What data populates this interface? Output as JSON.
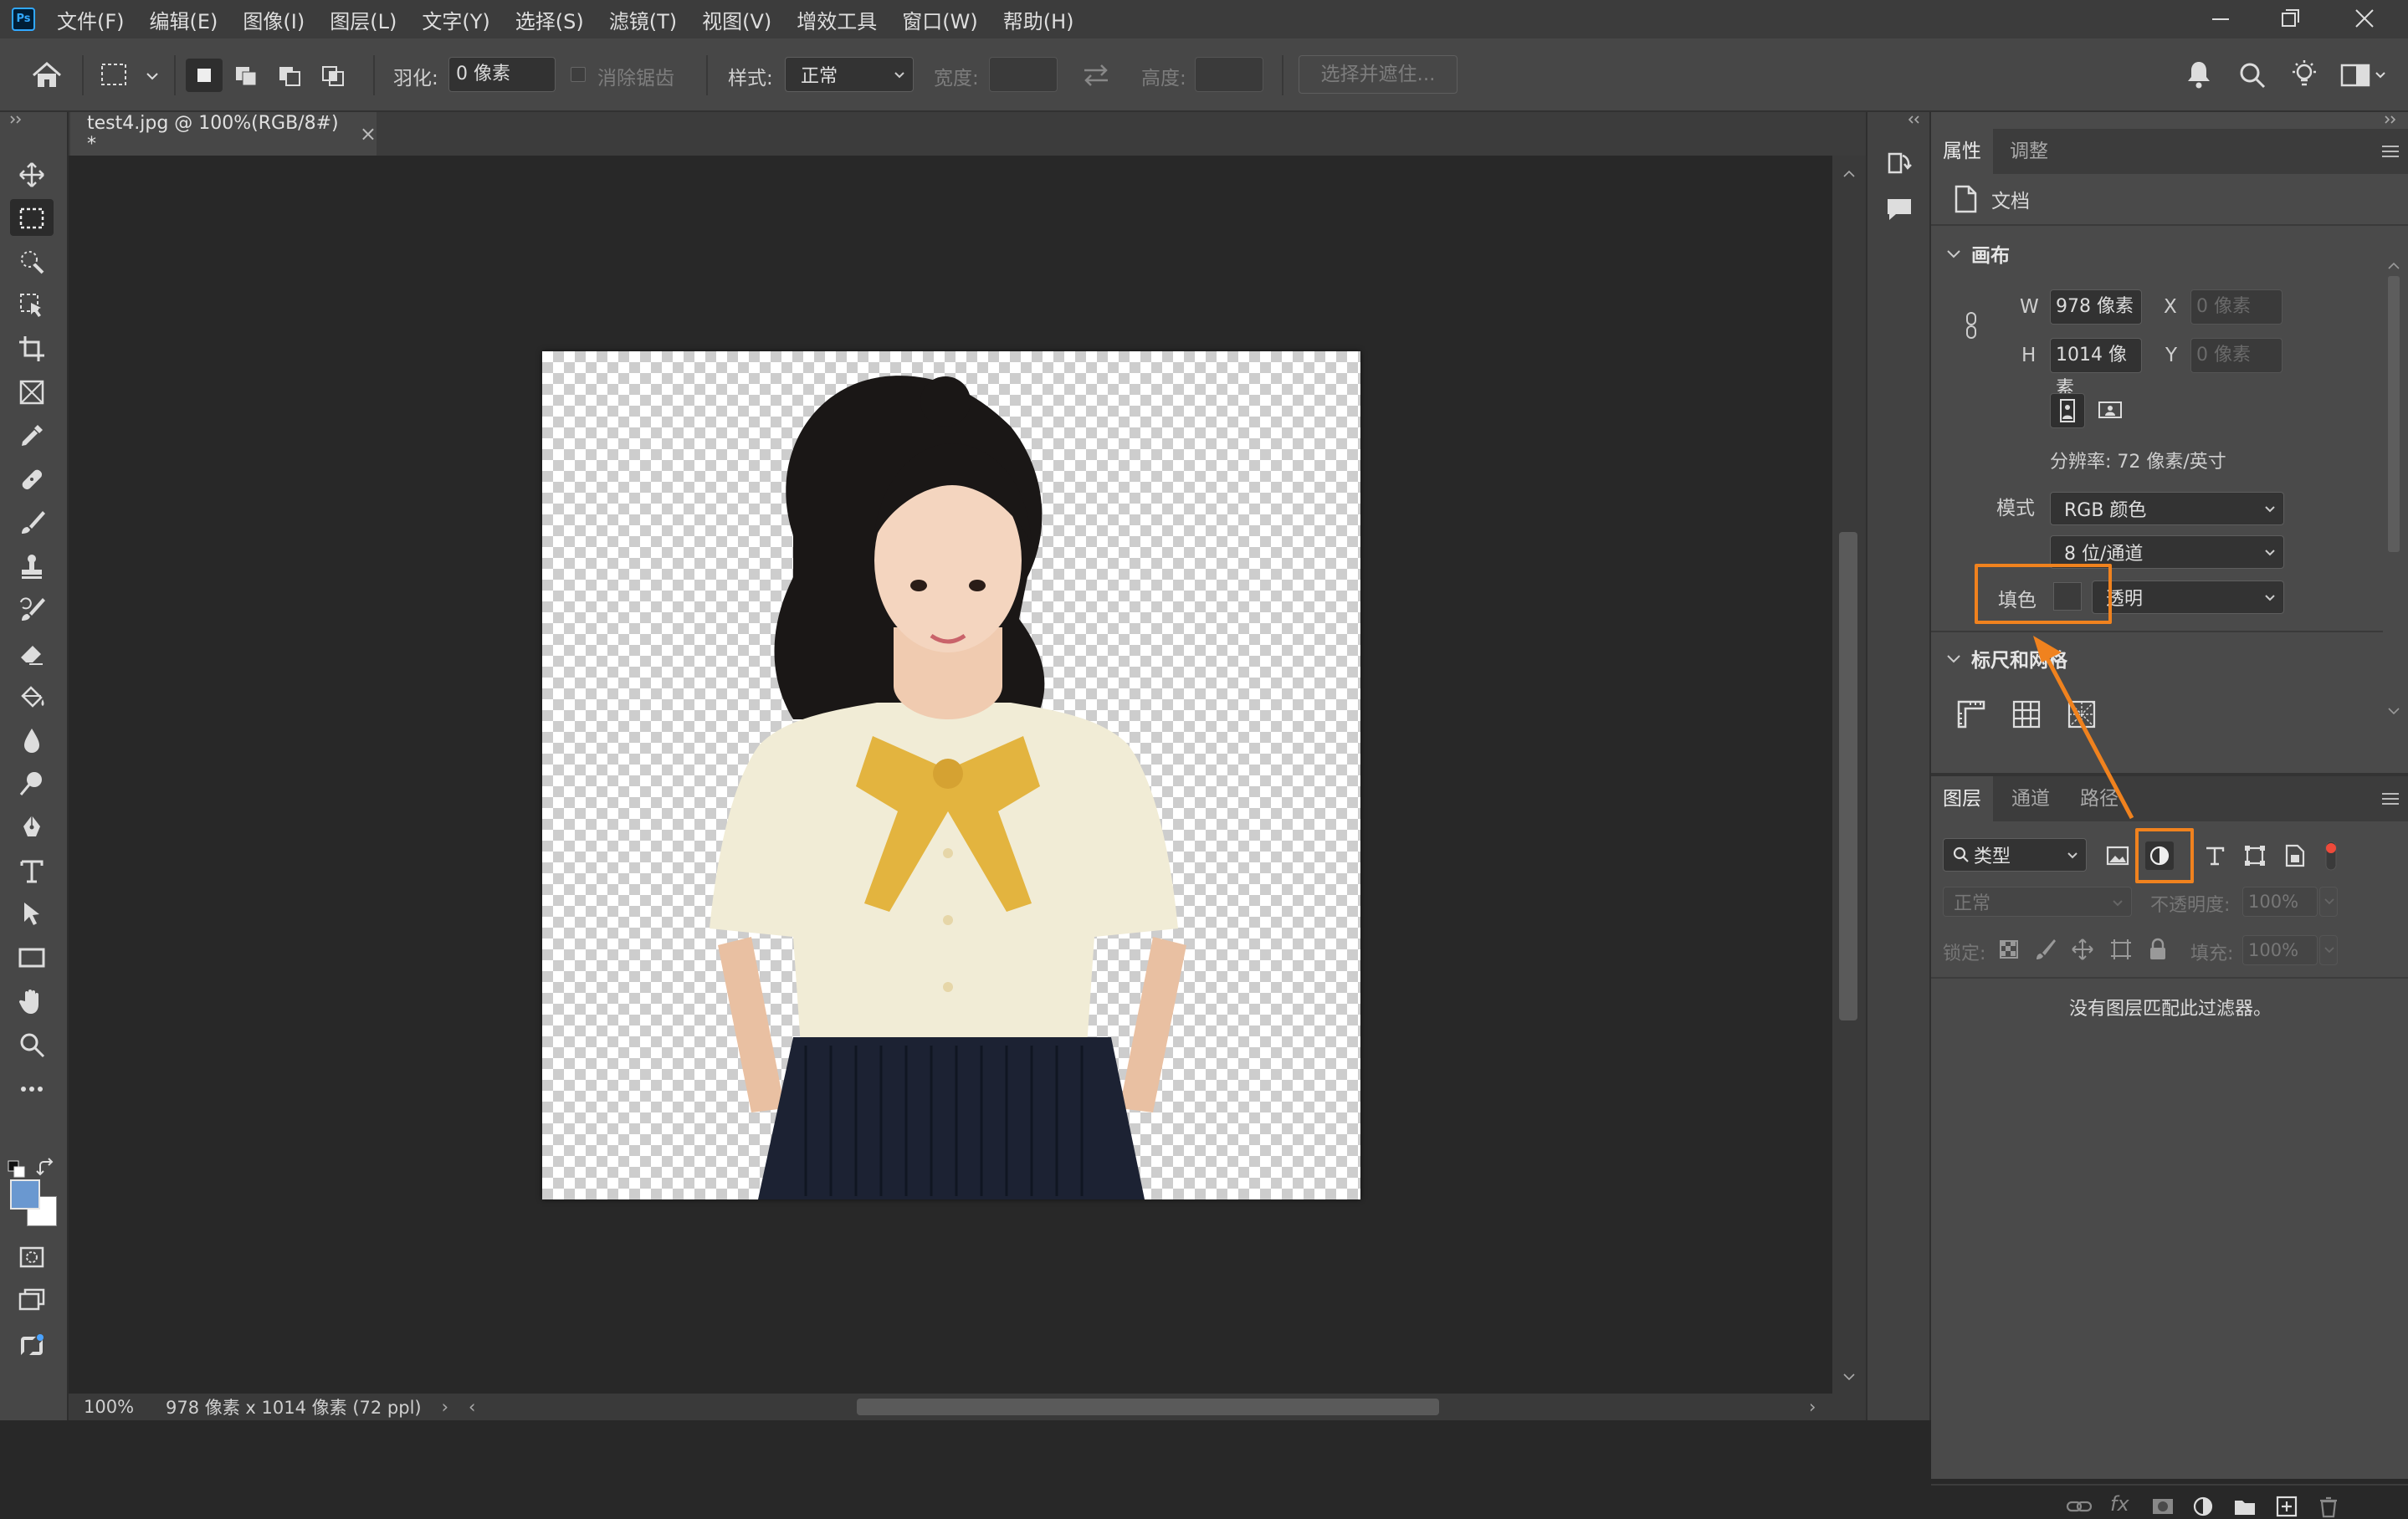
{
  "menu": {
    "items": [
      "文件(F)",
      "编辑(E)",
      "图像(I)",
      "图层(L)",
      "文字(Y)",
      "选择(S)",
      "滤镜(T)",
      "视图(V)",
      "增效工具",
      "窗口(W)",
      "帮助(H)"
    ],
    "app_icon": "Ps"
  },
  "options": {
    "feather_label": "羽化:",
    "feather_value": "0 像素",
    "antialias_label": "消除锯齿",
    "style_label": "样式:",
    "style_value": "正常",
    "width_label": "宽度:",
    "height_label": "高度:",
    "select_mask_button": "选择并遮住..."
  },
  "document": {
    "tab_title": "test4.jpg @ 100%(RGB/8#) *",
    "close": "×"
  },
  "status": {
    "zoom": "100%",
    "info": "978 像素 x 1014 像素 (72 ppl)"
  },
  "properties": {
    "tab_properties": "属性",
    "tab_adjustments": "调整",
    "doc_label": "文档",
    "canvas_header": "画布",
    "w_label": "W",
    "w_value": "978 像素",
    "h_label": "H",
    "h_value": "1014 像素",
    "x_label": "X",
    "x_placeholder": "0 像素",
    "y_label": "Y",
    "y_placeholder": "0 像素",
    "resolution": "分辨率: 72 像素/英寸",
    "mode_label": "模式",
    "mode_value": "RGB 颜色",
    "depth_value": "8 位/通道",
    "fill_label": "填色",
    "fill_value": "透明",
    "rulers_header": "标尺和网格"
  },
  "layers": {
    "tab_layers": "图层",
    "tab_channels": "通道",
    "tab_paths": "路径",
    "filter_kind": "类型",
    "blend_mode": "正常",
    "opacity_label": "不透明度:",
    "opacity_value": "100%",
    "lock_label": "锁定:",
    "fill_label": "填充:",
    "fill_value": "100%",
    "empty_message": "没有图层匹配此过滤器。"
  },
  "colors": {
    "highlight": "#f0821e",
    "foreground": "#6a98d0",
    "background": "#ffffff"
  }
}
